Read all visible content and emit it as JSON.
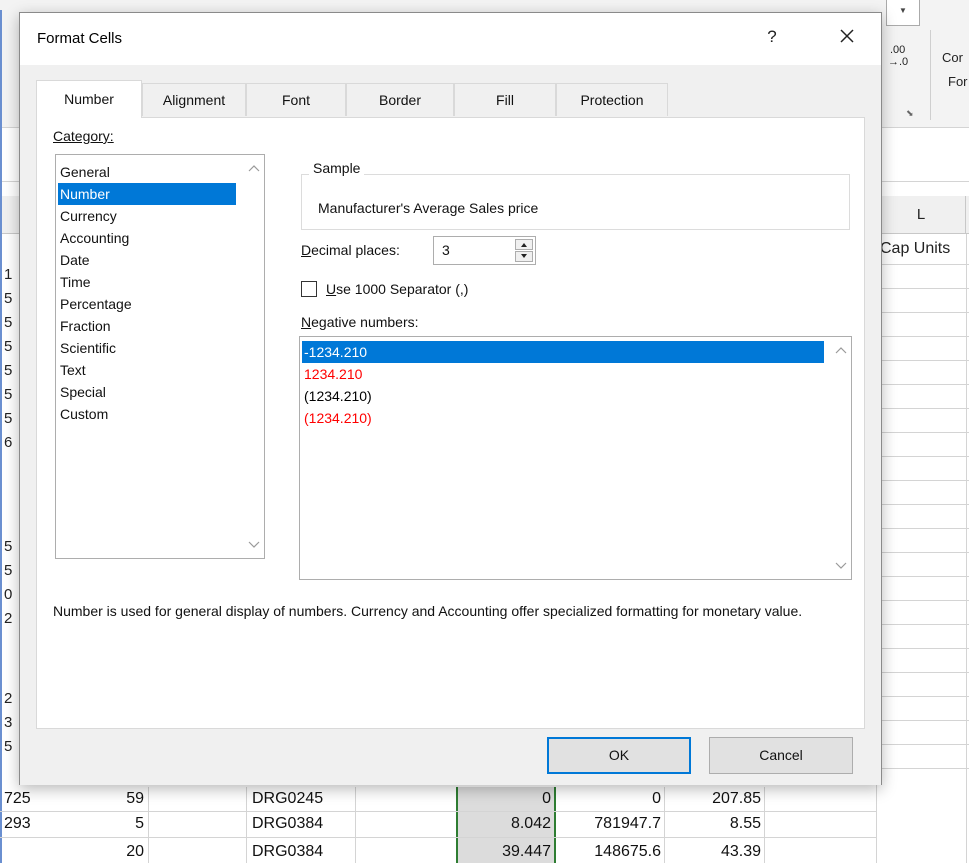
{
  "dialog": {
    "title": "Format Cells",
    "help": "?",
    "tabs": [
      "Number",
      "Alignment",
      "Font",
      "Border",
      "Fill",
      "Protection"
    ],
    "active_tab": "Number",
    "category_label": "Category:",
    "categories": [
      "General",
      "Number",
      "Currency",
      "Accounting",
      "Date",
      "Time",
      "Percentage",
      "Fraction",
      "Scientific",
      "Text",
      "Special",
      "Custom"
    ],
    "selected_category": "Number",
    "sample_label": "Sample",
    "sample_value": "Manufacturer's Average Sales price",
    "decimal_label": "Decimal places:",
    "decimal_value": "3",
    "separator_label": "Use 1000 Separator (,)",
    "separator_checked": false,
    "negative_label": "Negative numbers:",
    "negative_options": [
      {
        "text": "-1234.210",
        "color": "#000000"
      },
      {
        "text": "1234.210",
        "color": "#ff0000"
      },
      {
        "text": "(1234.210)",
        "color": "#000000"
      },
      {
        "text": "(1234.210)",
        "color": "#ff0000"
      }
    ],
    "selected_negative": 0,
    "description": "Number is used for general display of numbers.  Currency and Accounting offer specialized formatting for monetary value.",
    "ok_label": "OK",
    "cancel_label": "Cancel",
    "accent_color": "#0078d7"
  },
  "sheet": {
    "column_header_L": "L",
    "header_cell": "Cap Units",
    "ribbon_fragments": [
      "Cor",
      "For",
      ".00",
      "→.0"
    ],
    "left_fragments": [
      "1",
      "5",
      "5",
      "5",
      "5",
      "5",
      "5",
      "6",
      "5",
      "5",
      "0",
      "2",
      "2",
      "3",
      "5"
    ],
    "rows": [
      {
        "a": "725",
        "b": "59",
        "c": "DRG0245",
        "d": "0",
        "e": "0",
        "f": "207.85"
      },
      {
        "a": "293",
        "b": "5",
        "c": "DRG0384",
        "d": "8.042",
        "e": "781947.7",
        "f": "8.55"
      },
      {
        "a": "",
        "b": "20",
        "c": "DRG0384",
        "d": "39.447",
        "e": "148675.6",
        "f": "43.39"
      }
    ]
  }
}
